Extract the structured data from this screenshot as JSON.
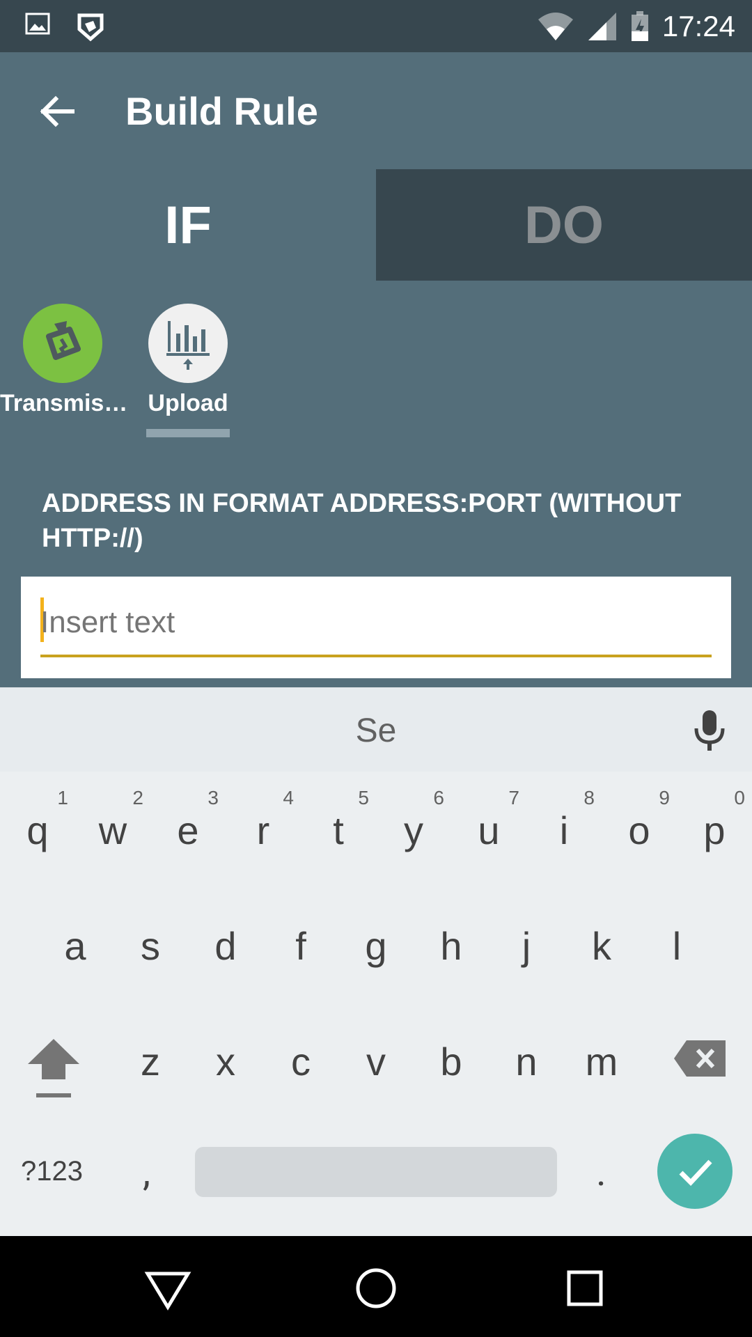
{
  "status_bar": {
    "time": "17:24",
    "icons": [
      "image-icon",
      "shield-icon",
      "wifi-icon",
      "signal-icon",
      "battery-icon"
    ]
  },
  "app_bar": {
    "title": "Build Rule",
    "back_icon": "arrow-back-icon"
  },
  "tabs": [
    {
      "label": "IF",
      "selected": true
    },
    {
      "label": "DO",
      "selected": false
    }
  ],
  "channels": [
    {
      "label": "Transmis…",
      "icon": "transmission-icon",
      "color": "#7CC142",
      "selected": false
    },
    {
      "label": "Upload",
      "icon": "upload-chart-icon",
      "color": "#F0F0F0",
      "selected": true
    }
  ],
  "form": {
    "prompt": "ADDRESS IN FORMAT ADDRESS:PORT (WITHOUT HTTP://)",
    "placeholder": "Insert text"
  },
  "keyboard": {
    "suggestion": "Se",
    "row1": [
      {
        "ch": "q",
        "num": "1"
      },
      {
        "ch": "w",
        "num": "2"
      },
      {
        "ch": "e",
        "num": "3"
      },
      {
        "ch": "r",
        "num": "4"
      },
      {
        "ch": "t",
        "num": "5"
      },
      {
        "ch": "y",
        "num": "6"
      },
      {
        "ch": "u",
        "num": "7"
      },
      {
        "ch": "i",
        "num": "8"
      },
      {
        "ch": "o",
        "num": "9"
      },
      {
        "ch": "p",
        "num": "0"
      }
    ],
    "row2": [
      "a",
      "s",
      "d",
      "f",
      "g",
      "h",
      "j",
      "k",
      "l"
    ],
    "row3": [
      "z",
      "x",
      "c",
      "v",
      "b",
      "n",
      "m"
    ],
    "sym": "?123",
    "comma": ",",
    "period": ".",
    "accent_color": "#4DB6AC"
  },
  "nav_bar": {
    "icons": [
      "back-triangle-icon",
      "home-circle-icon",
      "recents-square-icon"
    ]
  }
}
